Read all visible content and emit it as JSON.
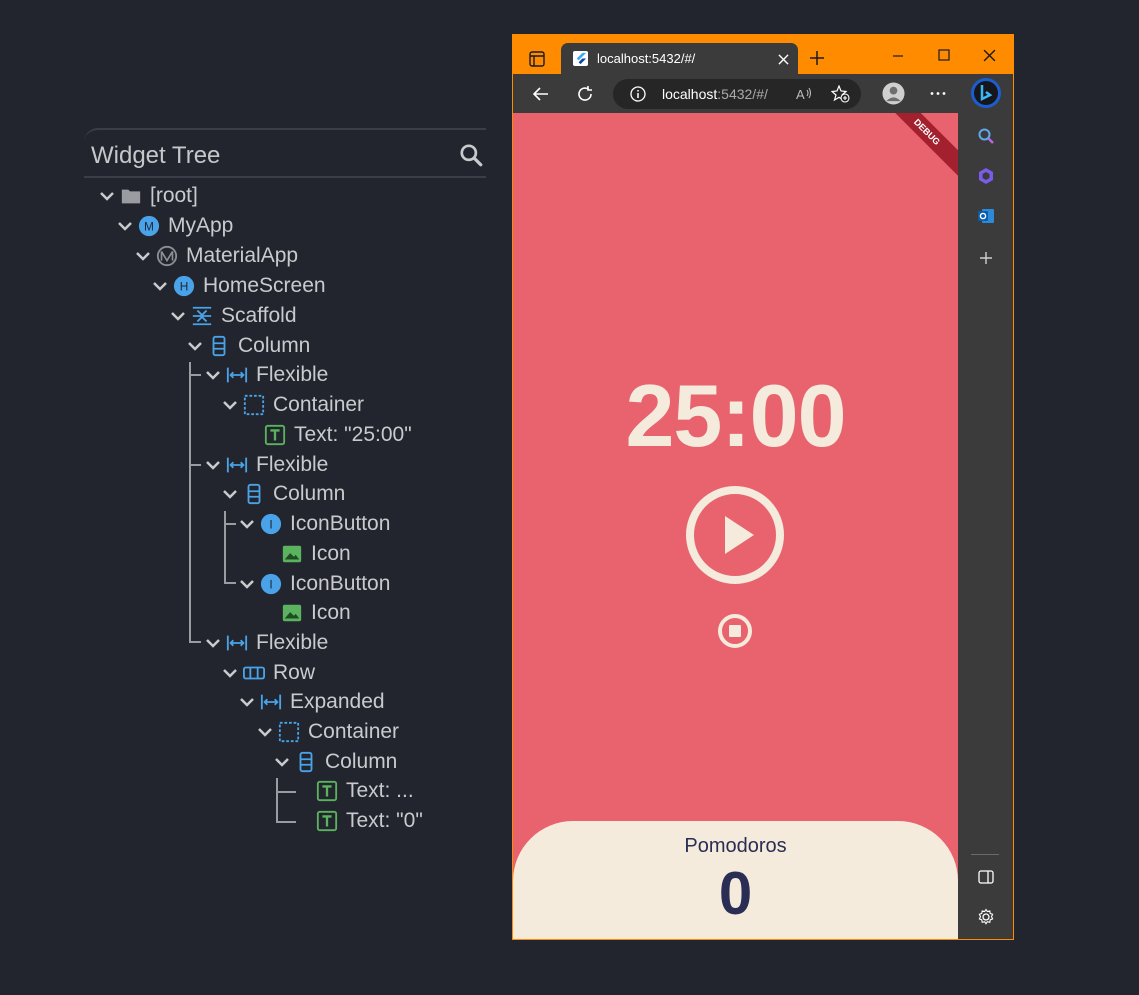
{
  "widget_tree": {
    "title": "Widget Tree",
    "nodes": [
      {
        "label": "[root]",
        "icon": "folder-icon"
      },
      {
        "label": "MyApp",
        "icon": "circle-M-icon"
      },
      {
        "label": "MaterialApp",
        "icon": "material-M-icon"
      },
      {
        "label": "HomeScreen",
        "icon": "circle-H-icon"
      },
      {
        "label": "Scaffold",
        "icon": "scaffold-icon"
      },
      {
        "label": "Column",
        "icon": "column-icon"
      },
      {
        "label": "Flexible",
        "icon": "flexible-icon"
      },
      {
        "label": "Container",
        "icon": "container-icon"
      },
      {
        "label": "Text: \"25:00\"",
        "icon": "text-T-icon"
      },
      {
        "label": "Flexible",
        "icon": "flexible-icon"
      },
      {
        "label": "Column",
        "icon": "column-icon"
      },
      {
        "label": "IconButton",
        "icon": "circle-I-icon"
      },
      {
        "label": "Icon",
        "icon": "image-icon"
      },
      {
        "label": "IconButton",
        "icon": "circle-I-icon"
      },
      {
        "label": "Icon",
        "icon": "image-icon"
      },
      {
        "label": "Flexible",
        "icon": "flexible-icon"
      },
      {
        "label": "Row",
        "icon": "row-icon"
      },
      {
        "label": "Expanded",
        "icon": "flexible-icon"
      },
      {
        "label": "Container",
        "icon": "container-icon"
      },
      {
        "label": "Column",
        "icon": "column-icon"
      },
      {
        "label": "Text: ...",
        "icon": "text-T-icon"
      },
      {
        "label": "Text: \"0\"",
        "icon": "text-T-icon"
      }
    ]
  },
  "browser": {
    "tab_title": "localhost:5432/#/",
    "url_host": "localhost",
    "url_path": ":5432/#/",
    "accent_color": "#ff8c00"
  },
  "app": {
    "timer": "25:00",
    "pomodoros_label": "Pomodoros",
    "pomodoros_count": "0",
    "debug_banner": "DEBUG",
    "background_color": "#e8636d",
    "foreground_color": "#f4ebdc",
    "text_color": "#2a2d54"
  }
}
